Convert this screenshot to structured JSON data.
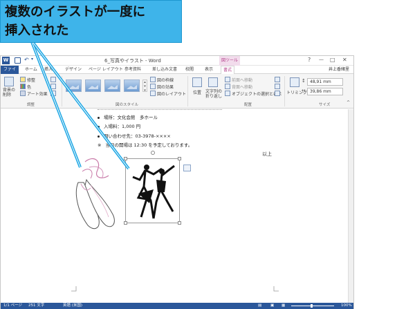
{
  "callout": {
    "text": "複数のイラストが一度に\n挿入された"
  },
  "titlebar": {
    "doc_title": "6_写真やイラスト - Word",
    "context_tab": "図ツール",
    "help": "?",
    "min": "—",
    "max": "□",
    "close": "✕"
  },
  "tabs": {
    "file": "ファイル",
    "home": "ホーム",
    "insert": "挿入",
    "design": "デザイン",
    "layout": "ページ レイアウト",
    "references": "参考資料",
    "mailings": "差し込み文書",
    "review": "校閲",
    "view": "表示",
    "format": "書式",
    "account": "井上香緒里"
  },
  "ribbon": {
    "remove_bg": "背景の削除",
    "corrections": "修整",
    "color": "色",
    "artistic": "アート効果",
    "group_adjust": "調整",
    "pic_border": "図の枠線",
    "pic_effects": "図の効果",
    "pic_layout": "図のレイアウト",
    "group_styles": "図のスタイル",
    "position": "位置",
    "wrap_text": "文字列の折り返し",
    "bring_forward": "前面へ移動",
    "send_backward": "背面へ移動",
    "selection_pane": "オブジェクトの選択と表示",
    "group_arrange": "配置",
    "crop": "トリミング",
    "height": "48,91 mm",
    "width": "39,86 mm",
    "group_size": "サイズ"
  },
  "document": {
    "line_place": "場所：文化会館　多ホール",
    "line_fee": "入場料：1,000 円",
    "line_contact": "問い合わせ先：03-3978-××××",
    "line_note": "当日の開場は 12:30 を予定しております。",
    "closing": "以上"
  },
  "status": {
    "page": "1/1 ページ",
    "words": "251 文字",
    "lang": "英語 (米国)",
    "zoom": "100%"
  }
}
